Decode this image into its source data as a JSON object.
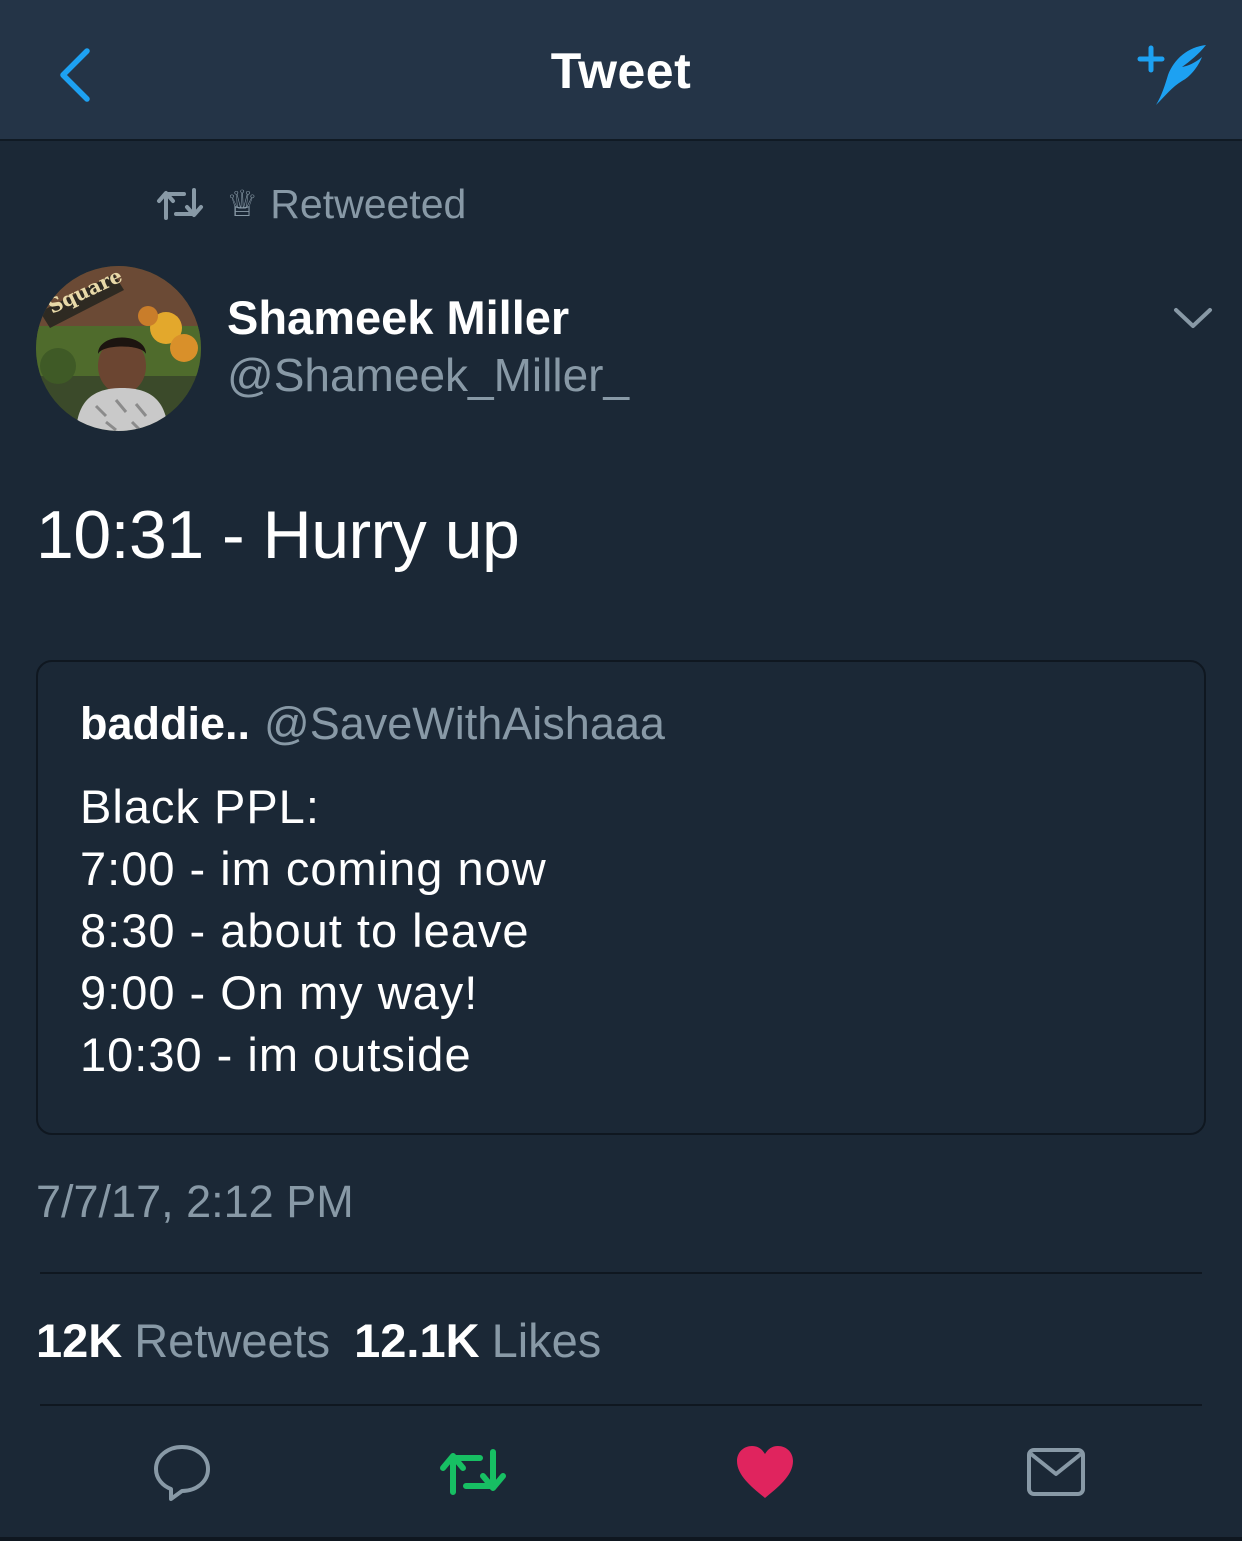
{
  "colors": {
    "background": "#1b2836",
    "nav_background": "#243447",
    "accent": "#1da1f2",
    "secondary_text": "#8899a6",
    "retweet_active": "#17bf63",
    "like_active": "#e0245e"
  },
  "nav": {
    "title": "Tweet",
    "back_icon": "chevron-left-icon",
    "compose_icon": "compose-tweet-icon"
  },
  "social_context": {
    "text": "Retweeted",
    "icons": [
      "retweet-icon",
      "crown-icon"
    ]
  },
  "tweet": {
    "author": {
      "name": "Shameek Miller",
      "handle": "@Shameek_Miller_",
      "avatar_sign_text": "Square"
    },
    "text": "10:31 - Hurry up",
    "quoted": {
      "name": "baddie..",
      "handle": "@SaveWithAishaaa",
      "lines": [
        "Black PPL:",
        "7:00 - im coming now",
        "8:30 - about to leave",
        "9:00 - On my way!",
        "10:30 - im outside"
      ]
    },
    "timestamp": "7/7/17, 2:12 PM",
    "stats": {
      "retweets_count": "12K",
      "retweets_label": "Retweets",
      "likes_count": "12.1K",
      "likes_label": "Likes"
    },
    "actions": {
      "reply_icon": "reply-icon",
      "retweet_icon": "retweet-icon",
      "like_icon": "heart-icon",
      "dm_icon": "envelope-icon",
      "retweeted": true,
      "liked": true
    }
  }
}
